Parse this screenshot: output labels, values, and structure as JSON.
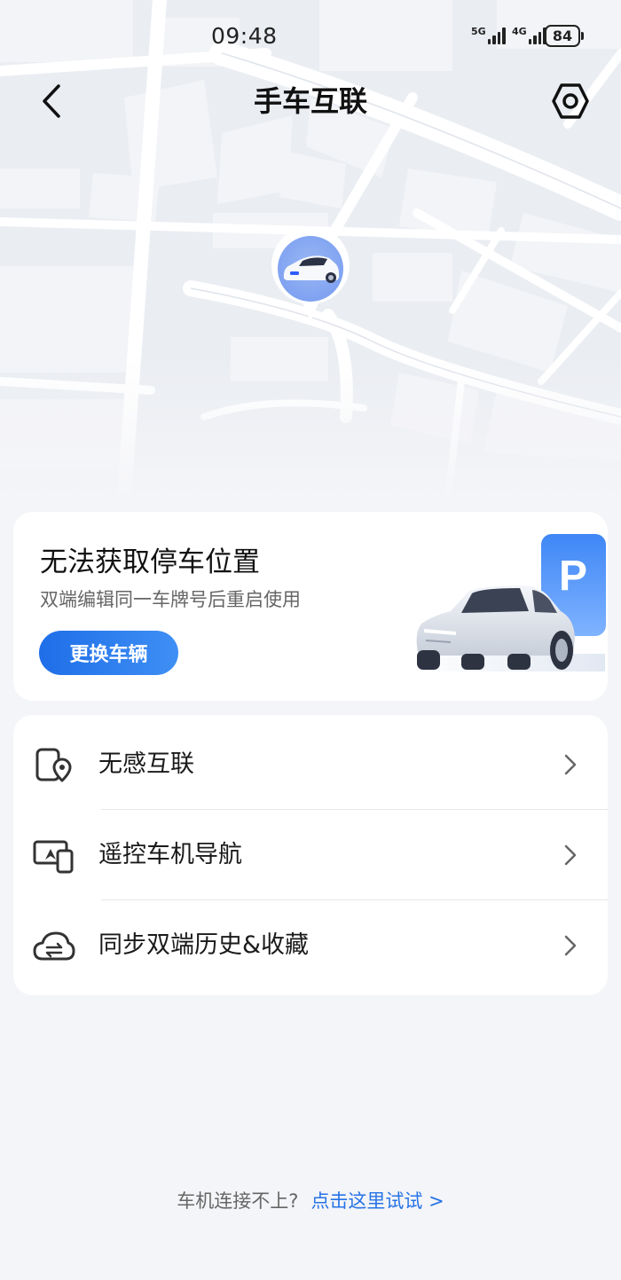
{
  "status_bar": {
    "time": "09:48",
    "net1_label": "5G",
    "net2_label": "4G",
    "battery": "84"
  },
  "header": {
    "title": "手车互联",
    "back_icon": "chevron-left-icon",
    "settings_icon": "hexagon-settings-icon"
  },
  "parking_card": {
    "title": "无法获取停车位置",
    "subtitle": "双端编辑同一车牌号后重启使用",
    "button_label": "更换车辆",
    "sign_letter": "P"
  },
  "menu": {
    "items": [
      {
        "label": "无感互联",
        "icon": "phone-location-icon"
      },
      {
        "label": "遥控车机导航",
        "icon": "screen-phone-navigation-icon"
      },
      {
        "label": "同步双端历史&收藏",
        "icon": "cloud-sync-icon"
      }
    ]
  },
  "footer": {
    "question": "车机连接不上?",
    "link": "点击这里试试 >"
  },
  "colors": {
    "accent": "#2673e6",
    "background": "#f4f5f8",
    "card": "#ffffff"
  }
}
